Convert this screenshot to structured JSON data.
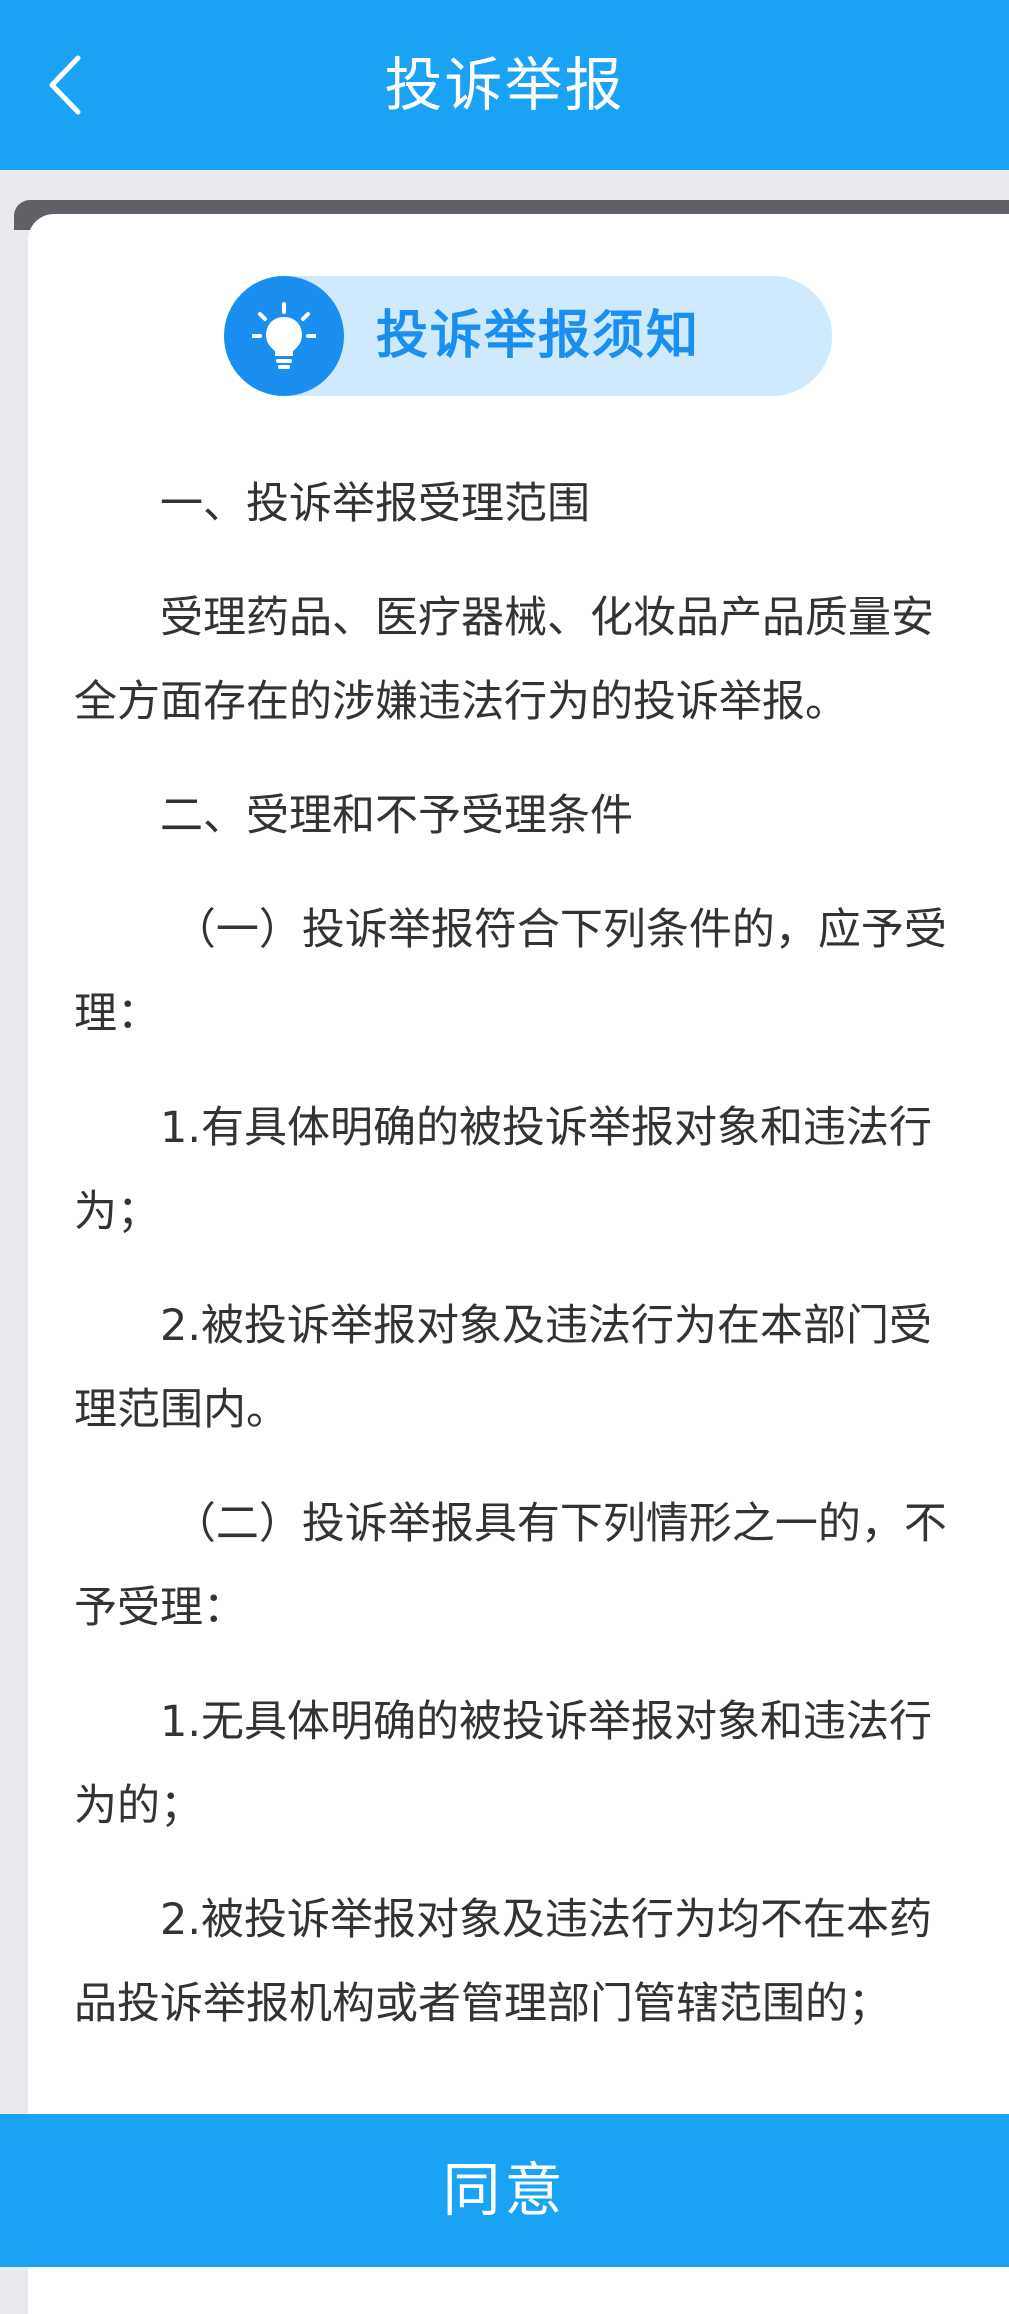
{
  "header": {
    "title": "投诉举报"
  },
  "notice": {
    "title": "投诉举报须知",
    "paragraphs": [
      "一、投诉举报受理范围",
      "受理药品、医疗器械、化妆品产品质量安全方面存在的涉嫌违法行为的投诉举报。",
      "二、受理和不予受理条件",
      "（一）投诉举报符合下列条件的，应予受理：",
      "1.有具体明确的被投诉举报对象和违法行为；",
      "2.被投诉举报对象及违法行为在本部门受理范围内。",
      "（二）投诉举报具有下列情形之一的，不予受理：",
      "1.无具体明确的被投诉举报对象和违法行为的；",
      "2.被投诉举报对象及违法行为均不在本药品投诉举报机构或者管理部门管辖范围的；"
    ]
  },
  "footer": {
    "agree_label": "同意"
  },
  "colors": {
    "primary": "#1aa3f5",
    "accent": "#1a8ff0",
    "pill_bg": "#cfe9fd",
    "text": "#333333"
  },
  "icons": {
    "back": "chevron-left-icon",
    "bulb": "lightbulb-icon"
  }
}
